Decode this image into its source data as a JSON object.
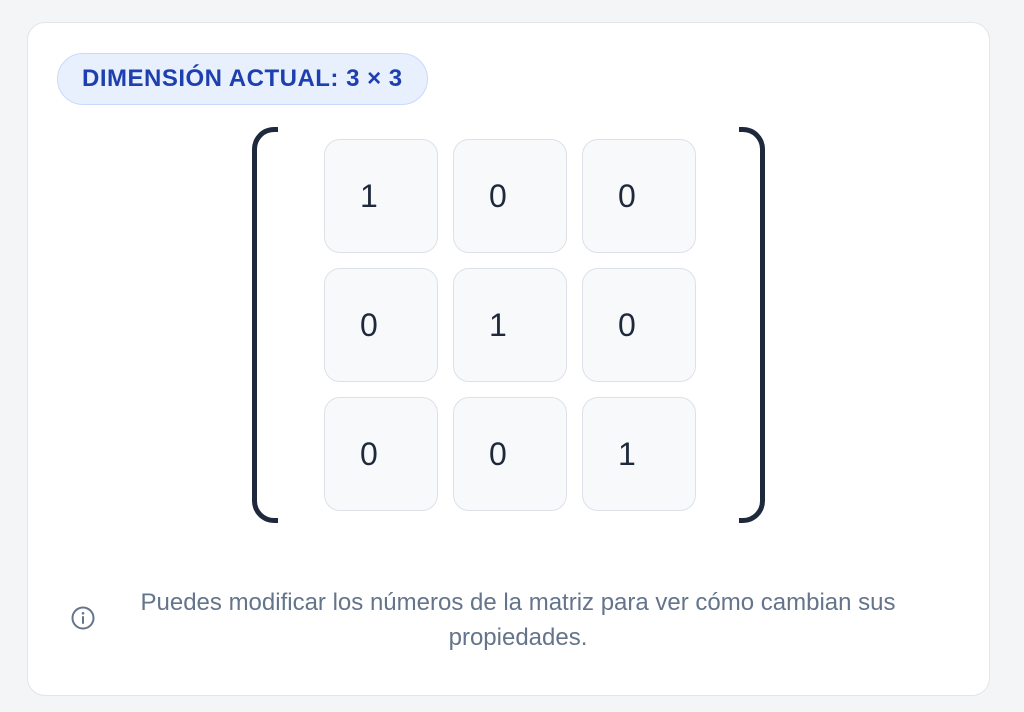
{
  "badge": {
    "label": "DIMENSIÓN ACTUAL: 3 × 3"
  },
  "matrix": {
    "rows": [
      [
        "1",
        "0",
        "0"
      ],
      [
        "0",
        "1",
        "0"
      ],
      [
        "0",
        "0",
        "1"
      ]
    ]
  },
  "info": {
    "icon": "info-icon",
    "text": "Puedes modificar los números de la matriz para ver cómo cambian sus propiedades."
  },
  "colors": {
    "accent": "#1e3fae",
    "badge_bg": "#e8f0fe",
    "bracket": "#1e293b",
    "muted_text": "#64748b"
  }
}
